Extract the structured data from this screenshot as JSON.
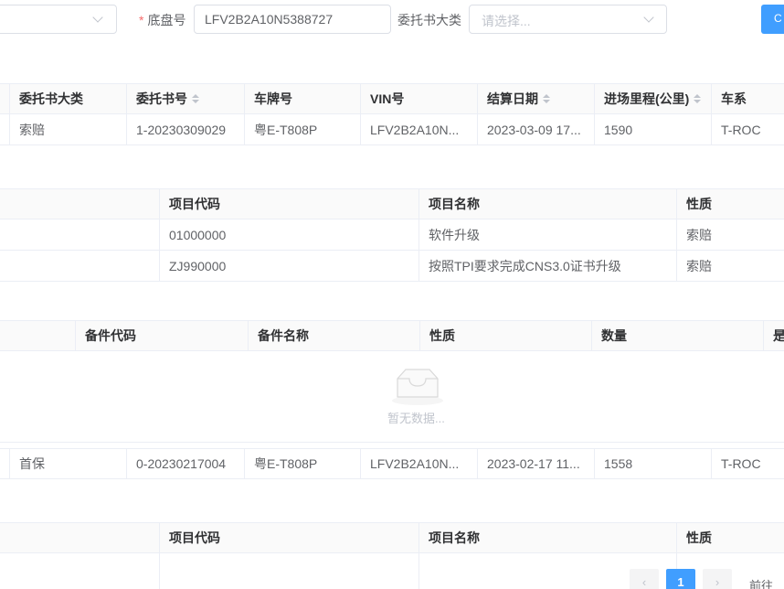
{
  "filters": {
    "first_select_placeholder": "",
    "chassis_label": "底盘号",
    "chassis_value": "LFV2B2A10N5388727",
    "category_label": "委托书大类",
    "category_placeholder": "请选择...",
    "query_button_label": "C"
  },
  "main_table": {
    "headers": [
      "委托书大类",
      "委托书号",
      "车牌号",
      "VIN号",
      "结算日期",
      "进场里程(公里)",
      "车系"
    ],
    "rows": [
      [
        "索赔",
        "1-20230309029",
        "粤E-T808P",
        "LFV2B2A10N...",
        "2023-03-09 17...",
        "1590",
        "T-ROC"
      ],
      [
        "首保",
        "0-20230217004",
        "粤E-T808P",
        "LFV2B2A10N...",
        "2023-02-17 11...",
        "1558",
        "T-ROC"
      ]
    ]
  },
  "items_table_1": {
    "headers": [
      "项目代码",
      "项目名称",
      "性质"
    ],
    "rows": [
      [
        "01000000",
        "软件升级",
        "索赔"
      ],
      [
        "ZJ990000",
        "按照TPI要求完成CNS3.0证书升级",
        "索赔"
      ]
    ]
  },
  "parts_table": {
    "headers": [
      "备件代码",
      "备件名称",
      "性质",
      "数量",
      "是"
    ],
    "empty_text": "暂无数据..."
  },
  "items_table_2": {
    "headers": [
      "项目代码",
      "项目名称",
      "性质"
    ]
  },
  "pagination": {
    "prev": "‹",
    "current_page": "1",
    "next": "›",
    "goto_label": "前往"
  }
}
